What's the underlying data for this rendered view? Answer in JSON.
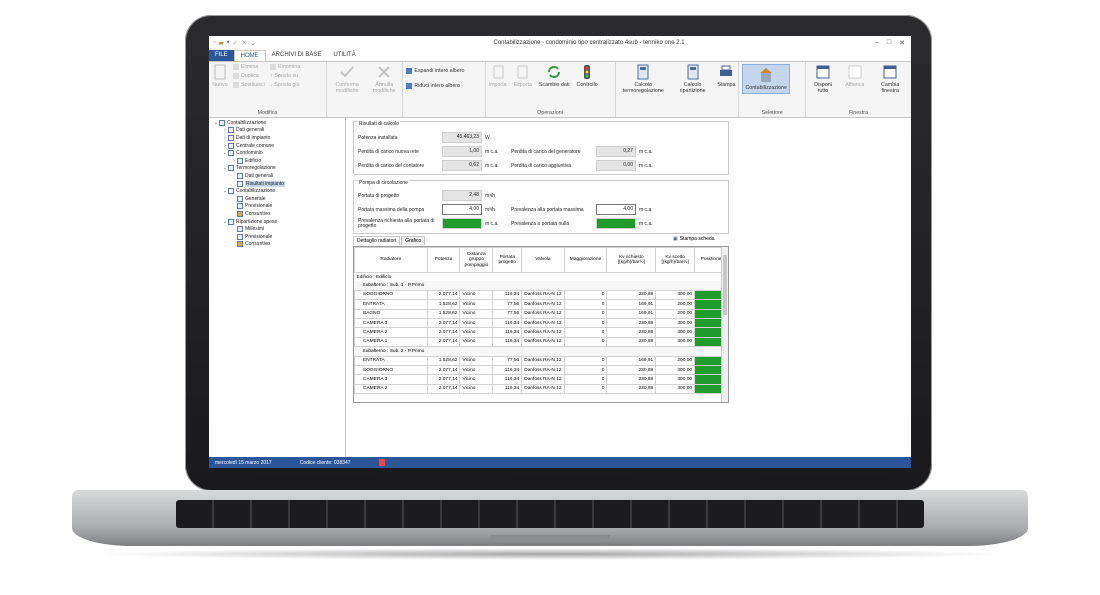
{
  "window": {
    "title": "Contabilizzazione - condominio tipo centralizzato 4sub - termiko one 2.1"
  },
  "tabs": [
    "FILE",
    "HOME",
    "ARCHIVI DI BASE",
    "UTILITÀ"
  ],
  "ribbon": {
    "nuovo": "Nuovo",
    "elimina": "Elimina",
    "duplica": "Duplica",
    "sostituisci": "Sostituisci",
    "rinomina": "Rinomina",
    "sposta_su": "Sposta su",
    "sposta_giu": "Sposta giù",
    "modifica_group": "Modifica",
    "conferma": "Conferma modifiche",
    "annulla": "Annulla modifiche",
    "espandi": "Espandi intero albero",
    "riduci": "Riduci intero albero",
    "importa": "Importa",
    "esporta": "Esporta",
    "scambio": "Scambio dati",
    "controllo": "Controllo",
    "operazioni_group": "Operazioni",
    "calcolo_termo": "Calcolo termoregolazione",
    "calcolo_rip": "Calcolo ripartizione",
    "stampa": "Stampa",
    "contabilizzazione": "Contabilizzazione",
    "selettore_group": "Selettore",
    "disponi": "Disponi tutto",
    "affianca": "Affianca",
    "cambia": "Cambia finestra",
    "finestra_group": "Finestra"
  },
  "tree": [
    {
      "label": "Contabilizzazione",
      "level": 0,
      "exp": "⌄"
    },
    {
      "label": "Dati generali",
      "level": 1,
      "exp": "›"
    },
    {
      "label": "Dati di impianto",
      "level": 1,
      "exp": "›"
    },
    {
      "label": "Centrale comune",
      "level": 1,
      "exp": "›"
    },
    {
      "label": "Condominio",
      "level": 1,
      "exp": "⌄"
    },
    {
      "label": "Edificio",
      "level": 2,
      "exp": "›"
    },
    {
      "label": "Termoregolazione",
      "level": 1,
      "exp": "⌄"
    },
    {
      "label": "Dati generali",
      "level": 2,
      "exp": ""
    },
    {
      "label": "Risultati impianto",
      "level": 2,
      "exp": "",
      "selected": true
    },
    {
      "label": "Contabilizzazione",
      "level": 1,
      "exp": "⌄"
    },
    {
      "label": "Generale",
      "level": 2,
      "exp": ""
    },
    {
      "label": "Previsionale",
      "level": 2,
      "exp": ""
    },
    {
      "label": "Consuntivo",
      "level": 2,
      "exp": ""
    },
    {
      "label": "Ripartizione spese",
      "level": 1,
      "exp": "⌄"
    },
    {
      "label": "Millesimi",
      "level": 2,
      "exp": ""
    },
    {
      "label": "Previsionale",
      "level": 2,
      "exp": ""
    },
    {
      "label": "Consuntivo",
      "level": 2,
      "exp": ""
    }
  ],
  "risultati": {
    "title": "Risultati di calcolo",
    "potenza_label": "Potenza installata",
    "potenza_value": "45.463,23",
    "potenza_unit": "W",
    "perdita_rete_label": "Perdita di carico nuova rete",
    "perdita_rete_value": "1,00",
    "perdita_rete_unit": "m c.a.",
    "perdita_gen_label": "Perdita di carico del generatore",
    "perdita_gen_value": "0,27",
    "perdita_gen_unit": "m c.a.",
    "perdita_cont_label": "Perdita di carico del contatore",
    "perdita_cont_value": "0,62",
    "perdita_cont_unit": "m c.a.",
    "perdita_agg_label": "Perdita di carico aggiuntiva",
    "perdita_agg_value": "0,00",
    "perdita_agg_unit": "m c.a."
  },
  "pompa": {
    "title": "Pompa di circolazione",
    "portata_label": "Portata di progetto",
    "portata_value": "2,48",
    "portata_unit": "m³/h",
    "portata_max_label": "Portata massima della pompa",
    "portata_max_value": "4,00",
    "portata_max_unit": "m³/h",
    "prev_max_label": "Prevalenza alla portata massima",
    "prev_max_value": "4,00",
    "prev_max_unit": "m c.a.",
    "prev_rich_label": "Prevalenza richiesta alla portata di progetto",
    "prev_rich_unit": "m c.a.",
    "prev_nulla_label": "Prevalenza a portata nulla",
    "prev_nulla_unit": "m c.a."
  },
  "subtabs": [
    "Dettaglio radiatori",
    "Grafico"
  ],
  "stampa_scheda": "Stampa scheda",
  "grid": {
    "headers": [
      "Radiatore",
      "Potenza",
      "Distanza gruppo pompaggio",
      "Portata progetto",
      "Valvola",
      "Maggiorazione",
      "Kv richiesto [(kg/h)/bar½]",
      "Kv scelto [(kg/h)/bar½]",
      "Posizione"
    ],
    "edificio": "Edificio : Edificio",
    "groups": [
      {
        "title": "Subalterno : Sub. 1 - P.Primo",
        "rows": [
          [
            "SOGGIORNO",
            "2.077,14",
            "Vicino",
            "116,34",
            "Danfoss RA-N 12",
            "0",
            "230,88",
            "300,00"
          ],
          [
            "ENTRATA",
            "1.528,62",
            "Vicino",
            "77,56",
            "Danfoss RA-N 12",
            "0",
            "169,91",
            "200,00"
          ],
          [
            "BAGNO",
            "1.528,62",
            "Vicino",
            "77,56",
            "Danfoss RA-N 12",
            "0",
            "169,91",
            "200,00"
          ],
          [
            "CAMERA 3",
            "2.077,14",
            "Vicino",
            "116,34",
            "Danfoss RA-N 12",
            "0",
            "230,88",
            "300,00"
          ],
          [
            "CAMERA 2",
            "2.077,14",
            "Vicino",
            "116,34",
            "Danfoss RA-N 12",
            "0",
            "230,88",
            "300,00"
          ],
          [
            "CAMERA 1",
            "2.077,14",
            "Vicino",
            "116,34",
            "Danfoss RA-N 12",
            "0",
            "230,88",
            "300,00"
          ]
        ]
      },
      {
        "title": "Subalterno : Sub. 2 - P.Primo",
        "rows": [
          [
            "ENTRATA",
            "1.528,62",
            "Vicino",
            "77,56",
            "Danfoss RA-N 12",
            "0",
            "169,91",
            "200,00"
          ],
          [
            "SOGGIORNO",
            "2.077,14",
            "Vicino",
            "116,34",
            "Danfoss RA-N 12",
            "0",
            "230,88",
            "300,00"
          ],
          [
            "CAMERA 3",
            "2.077,14",
            "Vicino",
            "116,34",
            "Danfoss RA-N 12",
            "0",
            "230,88",
            "300,00"
          ],
          [
            "CAMERA 2",
            "2.077,14",
            "Vicino",
            "116,34",
            "Danfoss RA-N 12",
            "0",
            "230,88",
            "300,00"
          ]
        ]
      }
    ]
  },
  "status": {
    "date": "mercoledì 15 marzo 2017",
    "client": "Codice cliente: 038347"
  },
  "colors": {
    "accent": "#2b579a",
    "ok_green": "#1f9c2b",
    "selection": "#c3d6ed"
  }
}
